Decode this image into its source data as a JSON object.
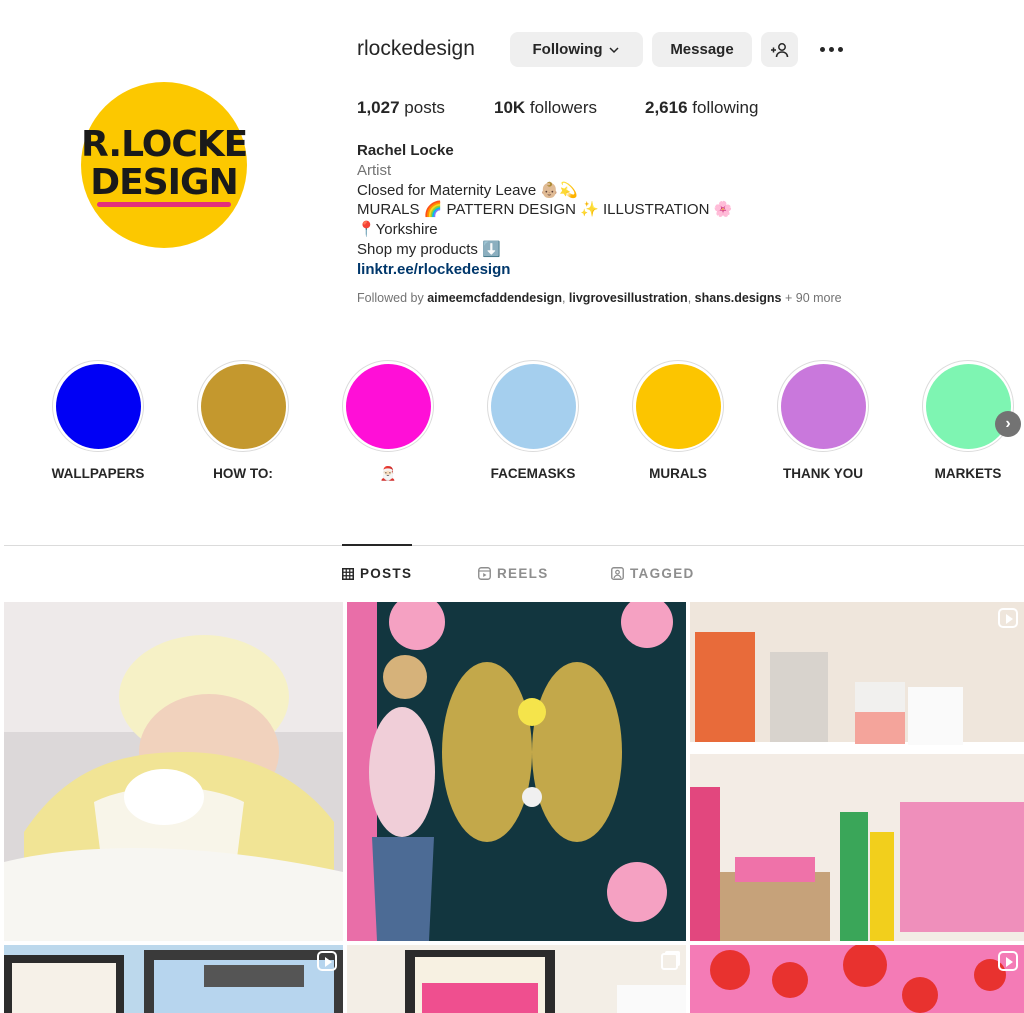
{
  "profile": {
    "username": "rlockedesign",
    "avatar_text_line1": "R.LOCKE",
    "avatar_text_line2": "DESIGN",
    "following_label": "Following",
    "message_label": "Message",
    "stats": {
      "posts_count": "1,027",
      "posts_label": "posts",
      "followers_count": "10K",
      "followers_label": "followers",
      "following_count": "2,616",
      "following_label": "following"
    },
    "bio": {
      "name": "Rachel Locke",
      "category": "Artist",
      "line1": "Closed for Maternity Leave 👶🏼💫",
      "line2": "MURALS 🌈 PATTERN DESIGN ✨ ILLUSTRATION 🌸",
      "line3": "📍Yorkshire",
      "line4": "Shop my products ⬇️",
      "link": "linktr.ee/rlockedesign"
    },
    "followed_by": {
      "prefix": "Followed by",
      "name1": "aimeemcfaddendesign",
      "name2": "livgrovesillustration",
      "name3": "shans.designs",
      "suffix": "+ 90 more"
    }
  },
  "highlights": [
    {
      "label": "WALLPAPERS",
      "color": "#0000f5"
    },
    {
      "label": "HOW TO:",
      "color": "#c4982e"
    },
    {
      "label": "🎅🏻",
      "color": "#ff0fd7"
    },
    {
      "label": "FACEMASKS",
      "color": "#a5cfee"
    },
    {
      "label": "MURALS",
      "color": "#fcc500"
    },
    {
      "label": "THANK YOU",
      "color": "#c978dc"
    },
    {
      "label": "MARKETS",
      "color": "#7ef5b2"
    }
  ],
  "tabs": {
    "posts": "POSTS",
    "reels": "REELS",
    "tagged": "TAGGED"
  },
  "icons": {
    "following_chevron": "chevron-down-icon",
    "add_user": "add-person-icon",
    "more": "more-horizontal-icon",
    "next_highlights": "chevron-right-icon",
    "posts_tab": "grid-icon",
    "reels_tab": "reels-icon",
    "tagged_tab": "tagged-icon"
  }
}
